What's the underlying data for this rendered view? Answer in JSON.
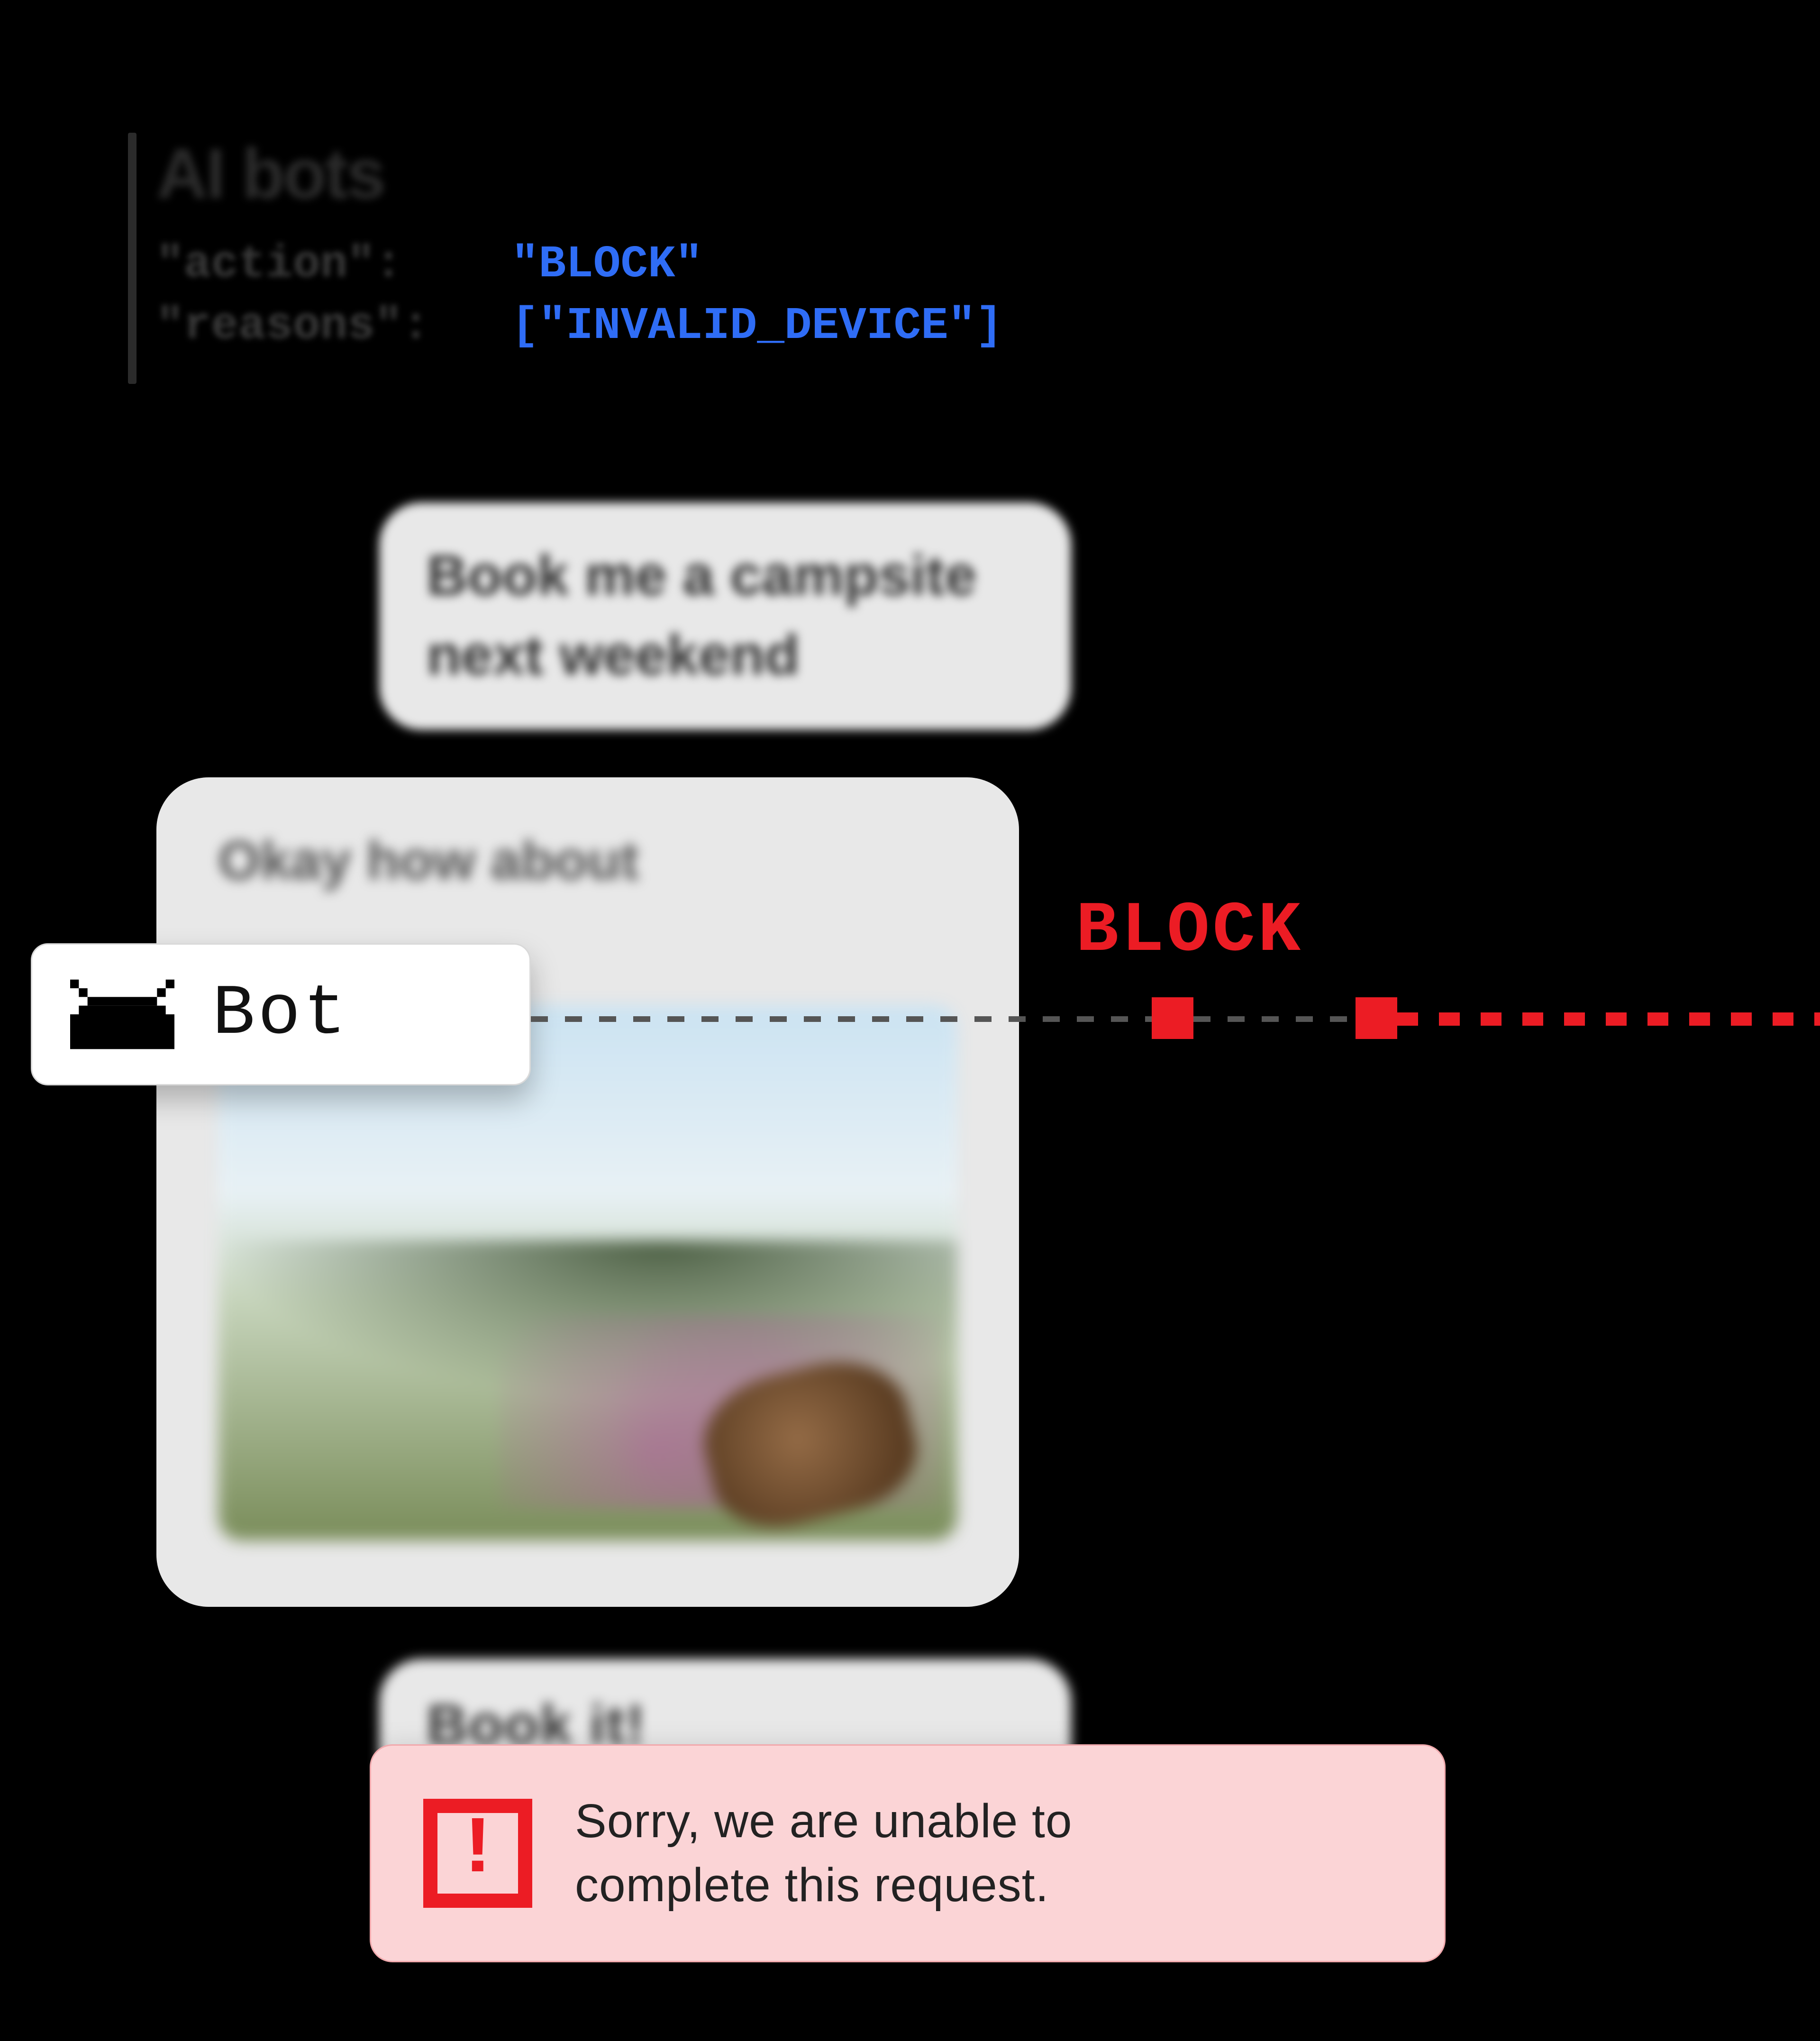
{
  "header": {
    "title": "AI bots",
    "action_key": "\"action\":",
    "action_value": "\"BLOCK\"",
    "reasons_key": "\"reasons\":",
    "reasons_value": "[\"INVALID_DEVICE\"]"
  },
  "chat": {
    "user1": "Book me a campsite next weekend",
    "bot_reply_text": "Okay how about",
    "user2": "Book it!"
  },
  "bot_badge": {
    "label": "Bot"
  },
  "block_label": "BLOCK",
  "error": {
    "bang": "!",
    "line1": "Sorry, we are unable to",
    "line2": "complete this request."
  }
}
